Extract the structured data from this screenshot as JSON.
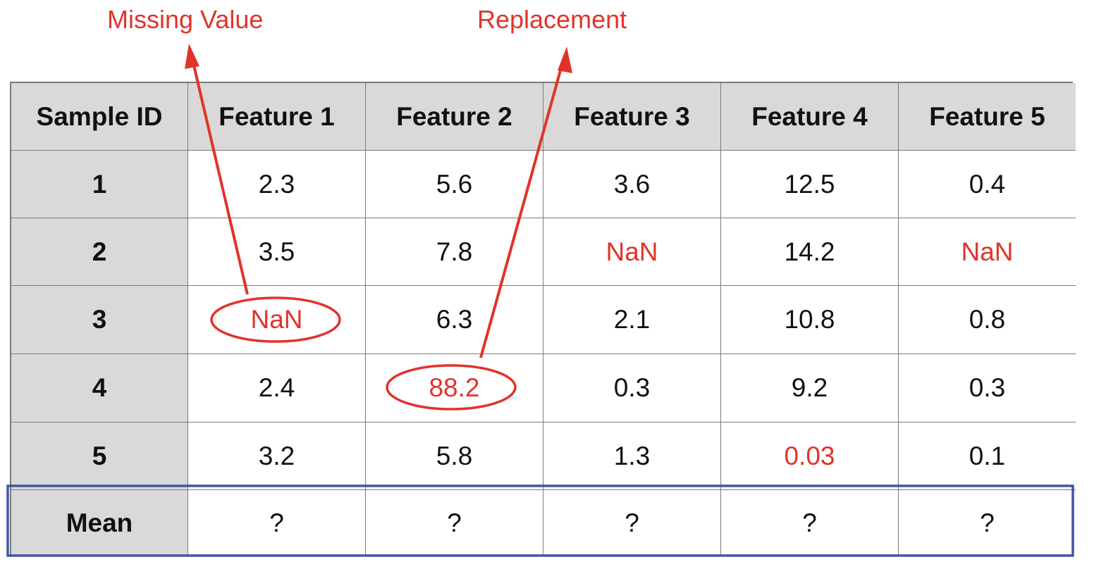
{
  "annotations": {
    "missing_value": "Missing Value",
    "replacement": "Replacement"
  },
  "colors": {
    "annotation": "#e0342a",
    "mean_row_border": "#3f56a6",
    "header_fill": "#d9d9d9",
    "grid_line": "#7a7a7a",
    "text": "#111111"
  },
  "table": {
    "headers": [
      "Sample ID",
      "Feature 1",
      "Feature 2",
      "Feature 3",
      "Feature 4",
      "Feature 5"
    ],
    "rows": [
      {
        "id": "1",
        "values": [
          "2.3",
          "5.6",
          "3.6",
          "12.5",
          "0.4"
        ],
        "highlight": [
          false,
          false,
          false,
          false,
          false
        ]
      },
      {
        "id": "2",
        "values": [
          "3.5",
          "7.8",
          "NaN",
          "14.2",
          "NaN"
        ],
        "highlight": [
          false,
          false,
          true,
          false,
          true
        ]
      },
      {
        "id": "3",
        "values": [
          "NaN",
          "6.3",
          "2.1",
          "10.8",
          "0.8"
        ],
        "highlight": [
          true,
          false,
          false,
          false,
          false
        ]
      },
      {
        "id": "4",
        "values": [
          "2.4",
          "88.2",
          "0.3",
          "9.2",
          "0.3"
        ],
        "highlight": [
          false,
          true,
          false,
          false,
          false
        ]
      },
      {
        "id": "5",
        "values": [
          "3.2",
          "5.8",
          "1.3",
          "0.03",
          "0.1"
        ],
        "highlight": [
          false,
          false,
          false,
          true,
          false
        ]
      }
    ],
    "mean_row": {
      "label": "Mean",
      "values": [
        "?",
        "?",
        "?",
        "?",
        "?"
      ]
    }
  }
}
